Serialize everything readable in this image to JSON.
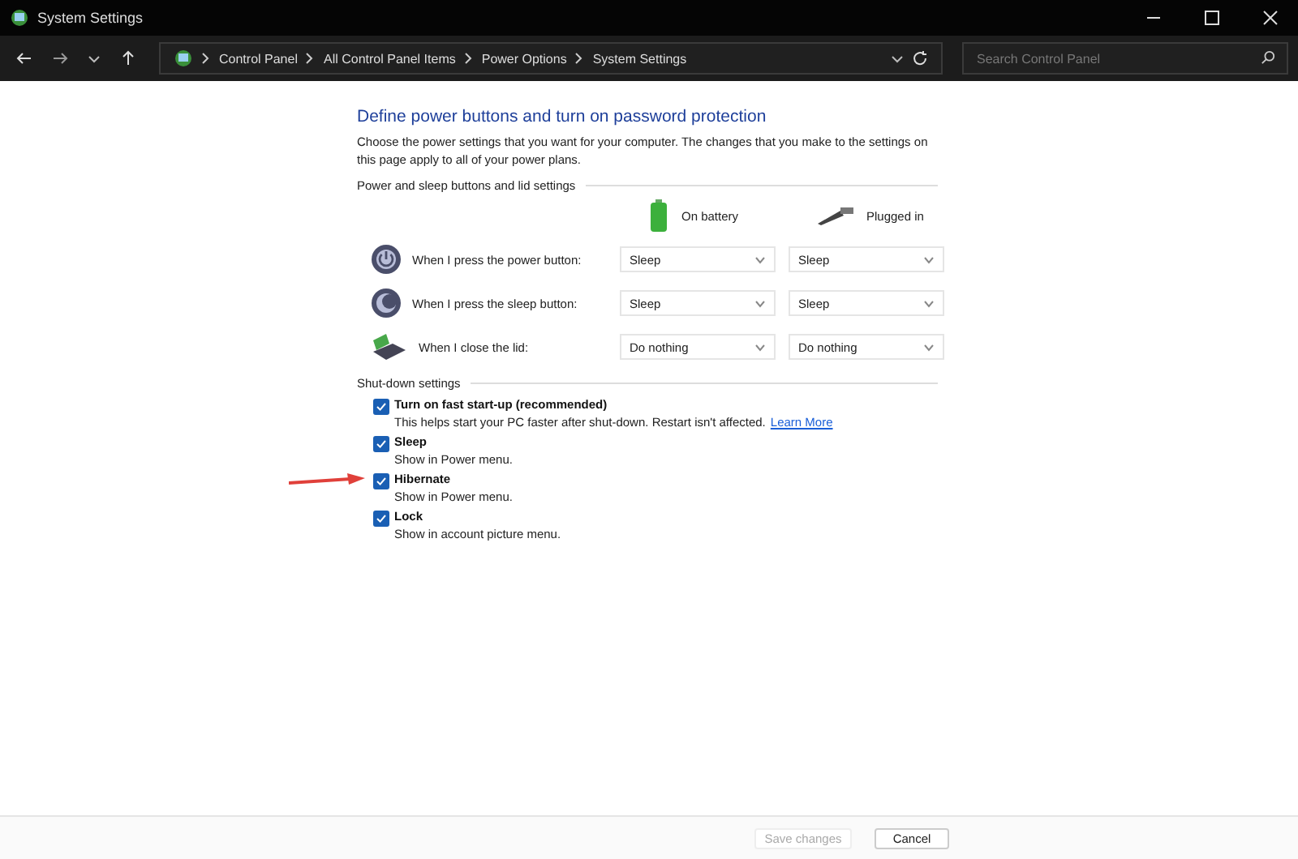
{
  "window": {
    "title": "System Settings"
  },
  "address_bar": {
    "breadcrumbs": [
      "Control Panel",
      "All Control Panel Items",
      "Power Options",
      "System Settings"
    ]
  },
  "search": {
    "placeholder": "Search Control Panel"
  },
  "heading": "Define power buttons and turn on password protection",
  "intro": "Choose the power settings that you want for your computer. The changes that you make to the settings on this page apply to all of your power plans.",
  "power_section": {
    "title": "Power and sleep buttons and lid settings",
    "columns": [
      {
        "kind": "battery",
        "label": "On battery"
      },
      {
        "kind": "plug",
        "label": "Plugged in"
      }
    ],
    "rows": [
      {
        "kind": "power",
        "label": "When I press the power button:",
        "values": [
          "Sleep",
          "Sleep"
        ]
      },
      {
        "kind": "sleep",
        "label": "When I press the sleep button:",
        "values": [
          "Sleep",
          "Sleep"
        ]
      },
      {
        "kind": "lid",
        "label": "When I close the lid:",
        "values": [
          "Do nothing",
          "Do nothing"
        ]
      }
    ]
  },
  "shutdown_section": {
    "title": "Shut-down settings",
    "items": [
      {
        "label": "Turn on fast start-up (recommended)",
        "description": "This helps start your PC faster after shut-down. Restart isn't affected.",
        "link": "Learn More",
        "checked": true,
        "pointed_at": false
      },
      {
        "label": "Sleep",
        "description": "Show in Power menu.",
        "checked": true,
        "pointed_at": false
      },
      {
        "label": "Hibernate",
        "description": "Show in Power menu.",
        "checked": true,
        "pointed_at": true
      },
      {
        "label": "Lock",
        "description": "Show in account picture menu.",
        "checked": true,
        "pointed_at": false
      }
    ]
  },
  "buttons": [
    {
      "label": "Save changes",
      "disabled": true
    },
    {
      "label": "Cancel",
      "disabled": false
    }
  ]
}
